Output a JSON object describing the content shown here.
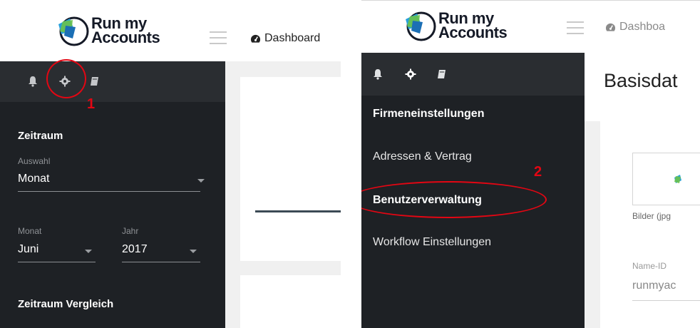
{
  "logo": {
    "line1": "Run my",
    "line2": "Accounts"
  },
  "nav": {
    "dashboard": "Dashboard",
    "dashboard_cut": "Dashboa"
  },
  "colors": {
    "sidebar": "#1e2125",
    "sidebar_top": "#2a2d31",
    "annotation": "#e30613",
    "content_bg": "#f0f0f0"
  },
  "icons": [
    "bell-icon",
    "gear-icon",
    "book-icon",
    "menu-icon",
    "tachometer-icon"
  ],
  "left_sidebar": {
    "zeitraum": "Zeitraum",
    "auswahl_label": "Auswahl",
    "auswahl_value": "Monat",
    "monat_label": "Monat",
    "monat_value": "Juni",
    "jahr_label": "Jahr",
    "jahr_value": "2017",
    "vergleich": "Zeitraum Vergleich"
  },
  "right_sidebar": {
    "heading": "Firmeneinstellungen",
    "items": [
      "Adressen & Vertrag",
      "Benutzerverwaltung",
      "Workflow Einstellungen"
    ]
  },
  "right_content": {
    "title": "Basisdat",
    "image_caption": "Bilder (jpg",
    "name_id_label": "Name-ID",
    "name_id_value": "runmyac"
  },
  "annotations": {
    "step1": "1",
    "step2": "2"
  }
}
